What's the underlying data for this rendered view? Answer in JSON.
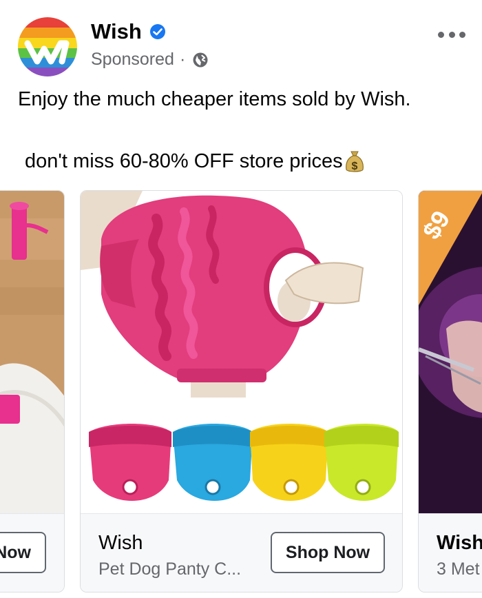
{
  "post": {
    "brand_name": "Wish",
    "sponsored": "Sponsored",
    "separator": "·",
    "caption_line1": "Enjoy the much cheaper items sold by Wish.",
    "caption_line2": "don't miss 60-80% OFF store prices"
  },
  "carousel": {
    "left_card": {
      "cta": "Now"
    },
    "main_card": {
      "title": "Wish",
      "subtitle": "Pet Dog Panty C...",
      "cta": "Shop Now"
    },
    "right_card": {
      "title": "Wish",
      "subtitle": "3 Met",
      "price_badge": "$9"
    }
  },
  "colors": {
    "accent_blue": "#1877f2",
    "secondary_text": "#65676b",
    "badge_orange": "#f0a040",
    "panty_colors": [
      "#e63b7a",
      "#2aa8e0",
      "#f7d21a",
      "#c9e82a"
    ]
  },
  "icons": [
    "verified-badge-icon",
    "globe-icon",
    "more-options-icon",
    "money-bag-icon"
  ]
}
